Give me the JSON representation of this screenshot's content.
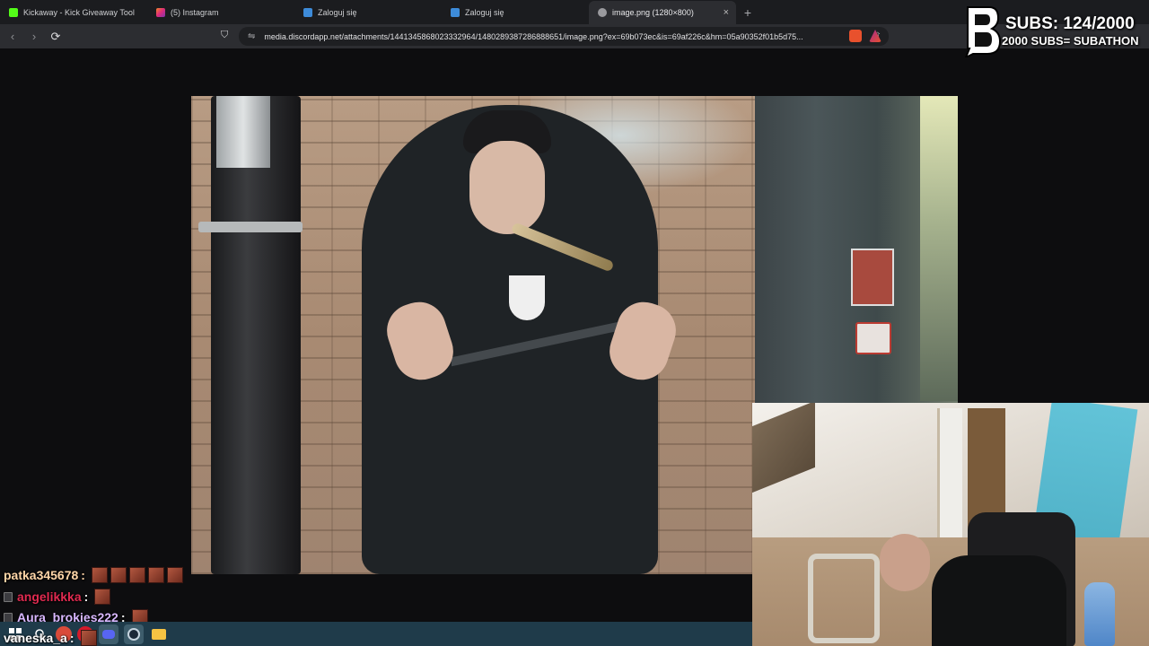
{
  "browser": {
    "tabs": [
      {
        "label": "Kickaway - Kick Giveaway Tool",
        "favicon": "kick-icon",
        "color": "#53fc18"
      },
      {
        "label": "(5) Instagram",
        "favicon": "instagram-icon",
        "color": "#e1306c"
      },
      {
        "label": "Zaloguj się",
        "favicon": "check-icon",
        "color": "#3d8bd9"
      },
      {
        "label": "Zaloguj się",
        "favicon": "check-icon",
        "color": "#3d8bd9"
      },
      {
        "label": "image.png (1280×800)",
        "favicon": "globe-icon",
        "color": "#9a9a9e",
        "active": true
      }
    ],
    "tab_close": "×",
    "new_tab": "+",
    "url": "media.discordapp.net/attachments/1441345868023332964/1480289387286888651/image.png?ex=69b073ec&is=69af226c&hm=05a90352f01b5d75...",
    "nav": {
      "back": "‹",
      "forward": "›",
      "reload": "⟳"
    },
    "bookmark_icon": "⛉",
    "site_icon": "⇋",
    "share_icon": "⇪"
  },
  "overlay": {
    "subs_count": "SUBS: 124/2000",
    "subs_goal": "2000 SUBS= SUBATHON"
  },
  "chat": [
    {
      "user": "patka345678",
      "sep": ":",
      "color": "#ffd6a8",
      "emotes": 5,
      "badge": false
    },
    {
      "user": "angelikkka",
      "sep": ":",
      "color": "#e02a50",
      "emotes": 1,
      "badge": true
    },
    {
      "user": "Aura_brokies222",
      "sep": ":",
      "color": "#d9b8ff",
      "emotes": 1,
      "badge": true
    },
    {
      "user": "vaneska_a",
      "sep": ":",
      "color": "#ffffff",
      "emotes": 1,
      "badge": false
    }
  ],
  "taskbar": {
    "icons": [
      "windows-start-icon",
      "search-icon",
      "app-icon",
      "opera-gx-icon",
      "discord-icon",
      "steam-icon",
      "file-explorer-icon"
    ]
  },
  "colors": {
    "background": "#0d0d0f",
    "tabstrip": "#1b1c1f",
    "toolbar": "#2c2d31",
    "taskbar": "#1f3b4a"
  }
}
